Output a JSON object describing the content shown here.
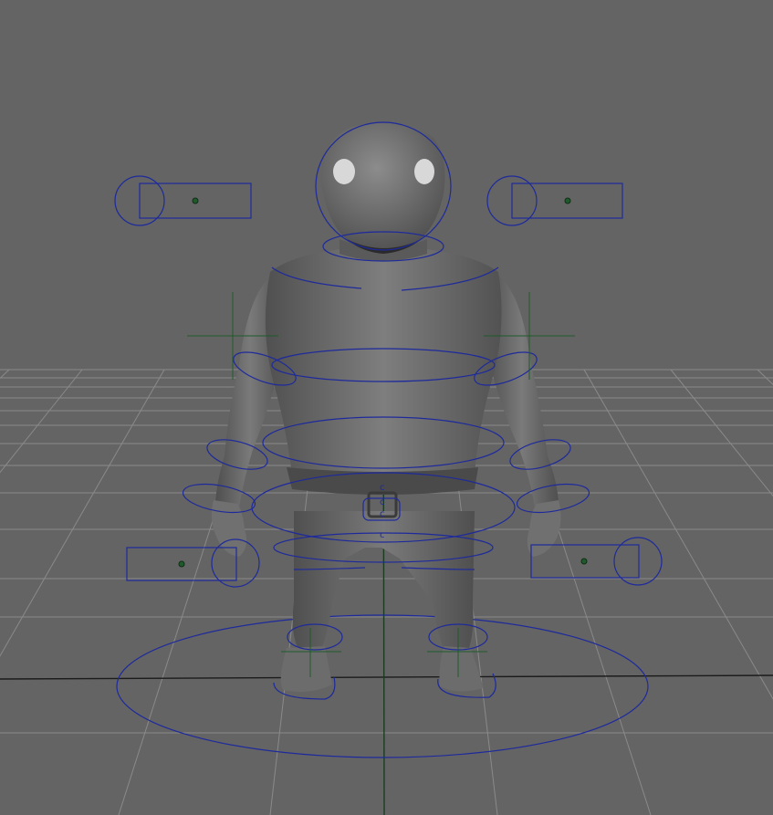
{
  "viewport": {
    "background": "#646464",
    "grid_color": "#8a8a8a",
    "controller_color": "#1e2a9c",
    "locator_color": "#1f5a2c"
  },
  "rig_labels": {
    "belt_top": "c",
    "belt_mid_1": "c",
    "belt_mid_2": "c",
    "hip": "c"
  }
}
